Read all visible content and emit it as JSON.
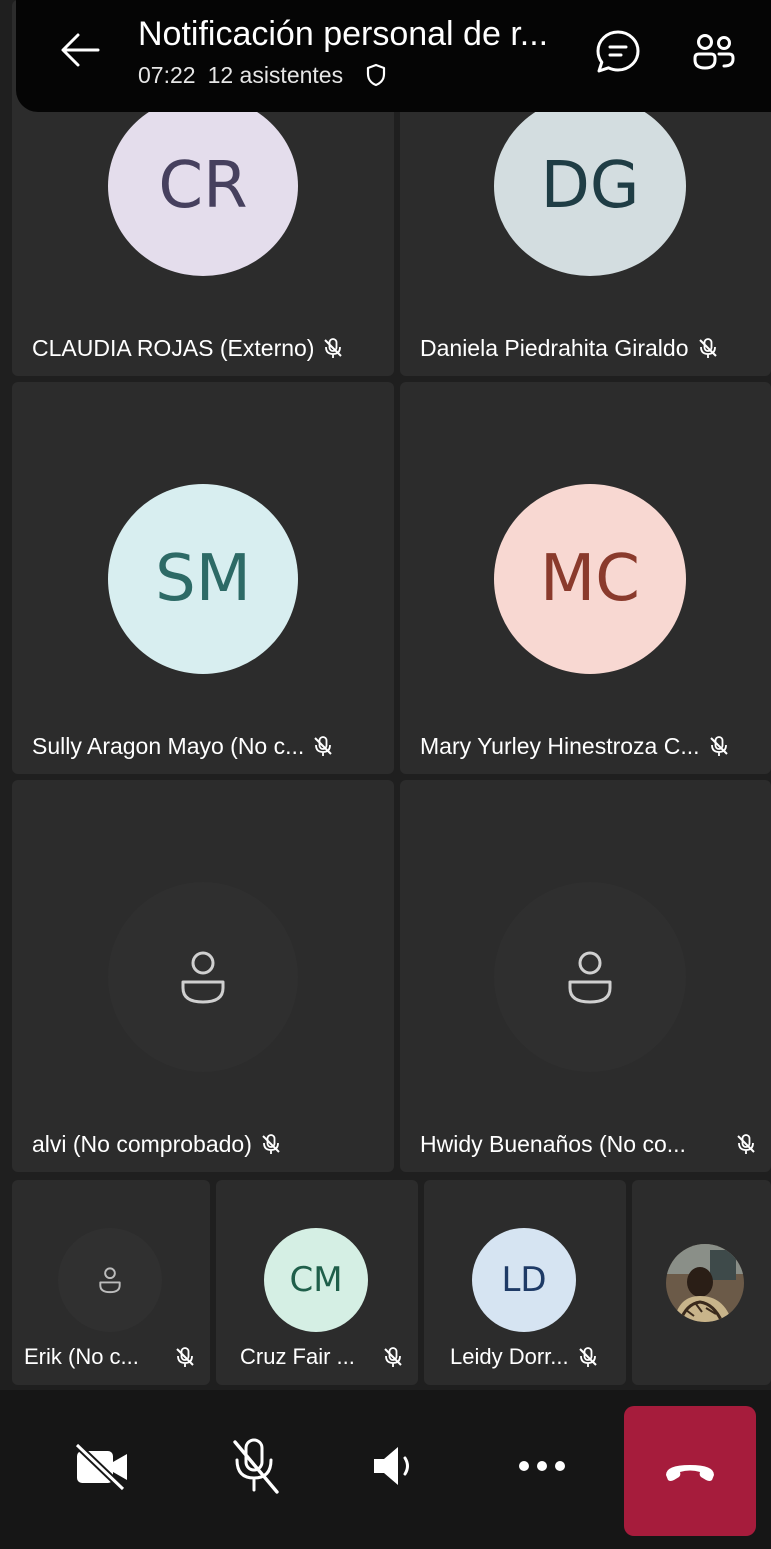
{
  "header": {
    "title": "Notificación personal de r...",
    "time": "07:22",
    "attendees": "12 asistentes"
  },
  "participants": [
    {
      "initials": "CR",
      "name": "CLAUDIA ROJAS (Externo)",
      "avatar_bg": "#e4ddec",
      "avatar_fg": "#46405e"
    },
    {
      "initials": "DG",
      "name": "Daniela  Piedrahita Giraldo",
      "avatar_bg": "#d3dde0",
      "avatar_fg": "#1f3d45"
    },
    {
      "initials": "SM",
      "name": "Sully  Aragon Mayo (No c...",
      "avatar_bg": "#d8eef0",
      "avatar_fg": "#2d6a66"
    },
    {
      "initials": "MC",
      "name": "Mary Yurley Hinestroza C...",
      "avatar_bg": "#f8d8d2",
      "avatar_fg": "#8a3a2c"
    },
    {
      "initials": "",
      "name": "alvi (No comprobado)",
      "avatar_bg": "#2f2f2f",
      "avatar_fg": "#d0d0d0"
    },
    {
      "initials": "",
      "name": "Hwidy Buenaños (No co...",
      "avatar_bg": "#2f2f2f",
      "avatar_fg": "#d0d0d0"
    }
  ],
  "strip": [
    {
      "initials": "",
      "name": "Erik (No c...",
      "avatar_bg": "#303030",
      "avatar_fg": "#bcbcbc"
    },
    {
      "initials": "CM",
      "name": "Cruz Fair ...",
      "avatar_bg": "#d5efe4",
      "avatar_fg": "#1f5f4a"
    },
    {
      "initials": "LD",
      "name": "Leidy Dorr...",
      "avatar_bg": "#d6e4f2",
      "avatar_fg": "#1e3a66"
    },
    {
      "initials": "",
      "name": "",
      "avatar_bg": "#5b4a3a",
      "avatar_fg": "#ffffff"
    }
  ],
  "colors": {
    "background": "#1f1f1f",
    "tile": "#2c2c2c",
    "header": "#050505",
    "hangup": "#a61c3c"
  },
  "icons": {
    "back": "arrow-left-icon",
    "chat": "chat-icon",
    "people": "people-icon",
    "camera_off": "camera-off-icon",
    "mic_off": "mic-off-icon",
    "speaker": "speaker-icon",
    "more": "more-icon",
    "hangup": "phone-hangup-icon"
  }
}
